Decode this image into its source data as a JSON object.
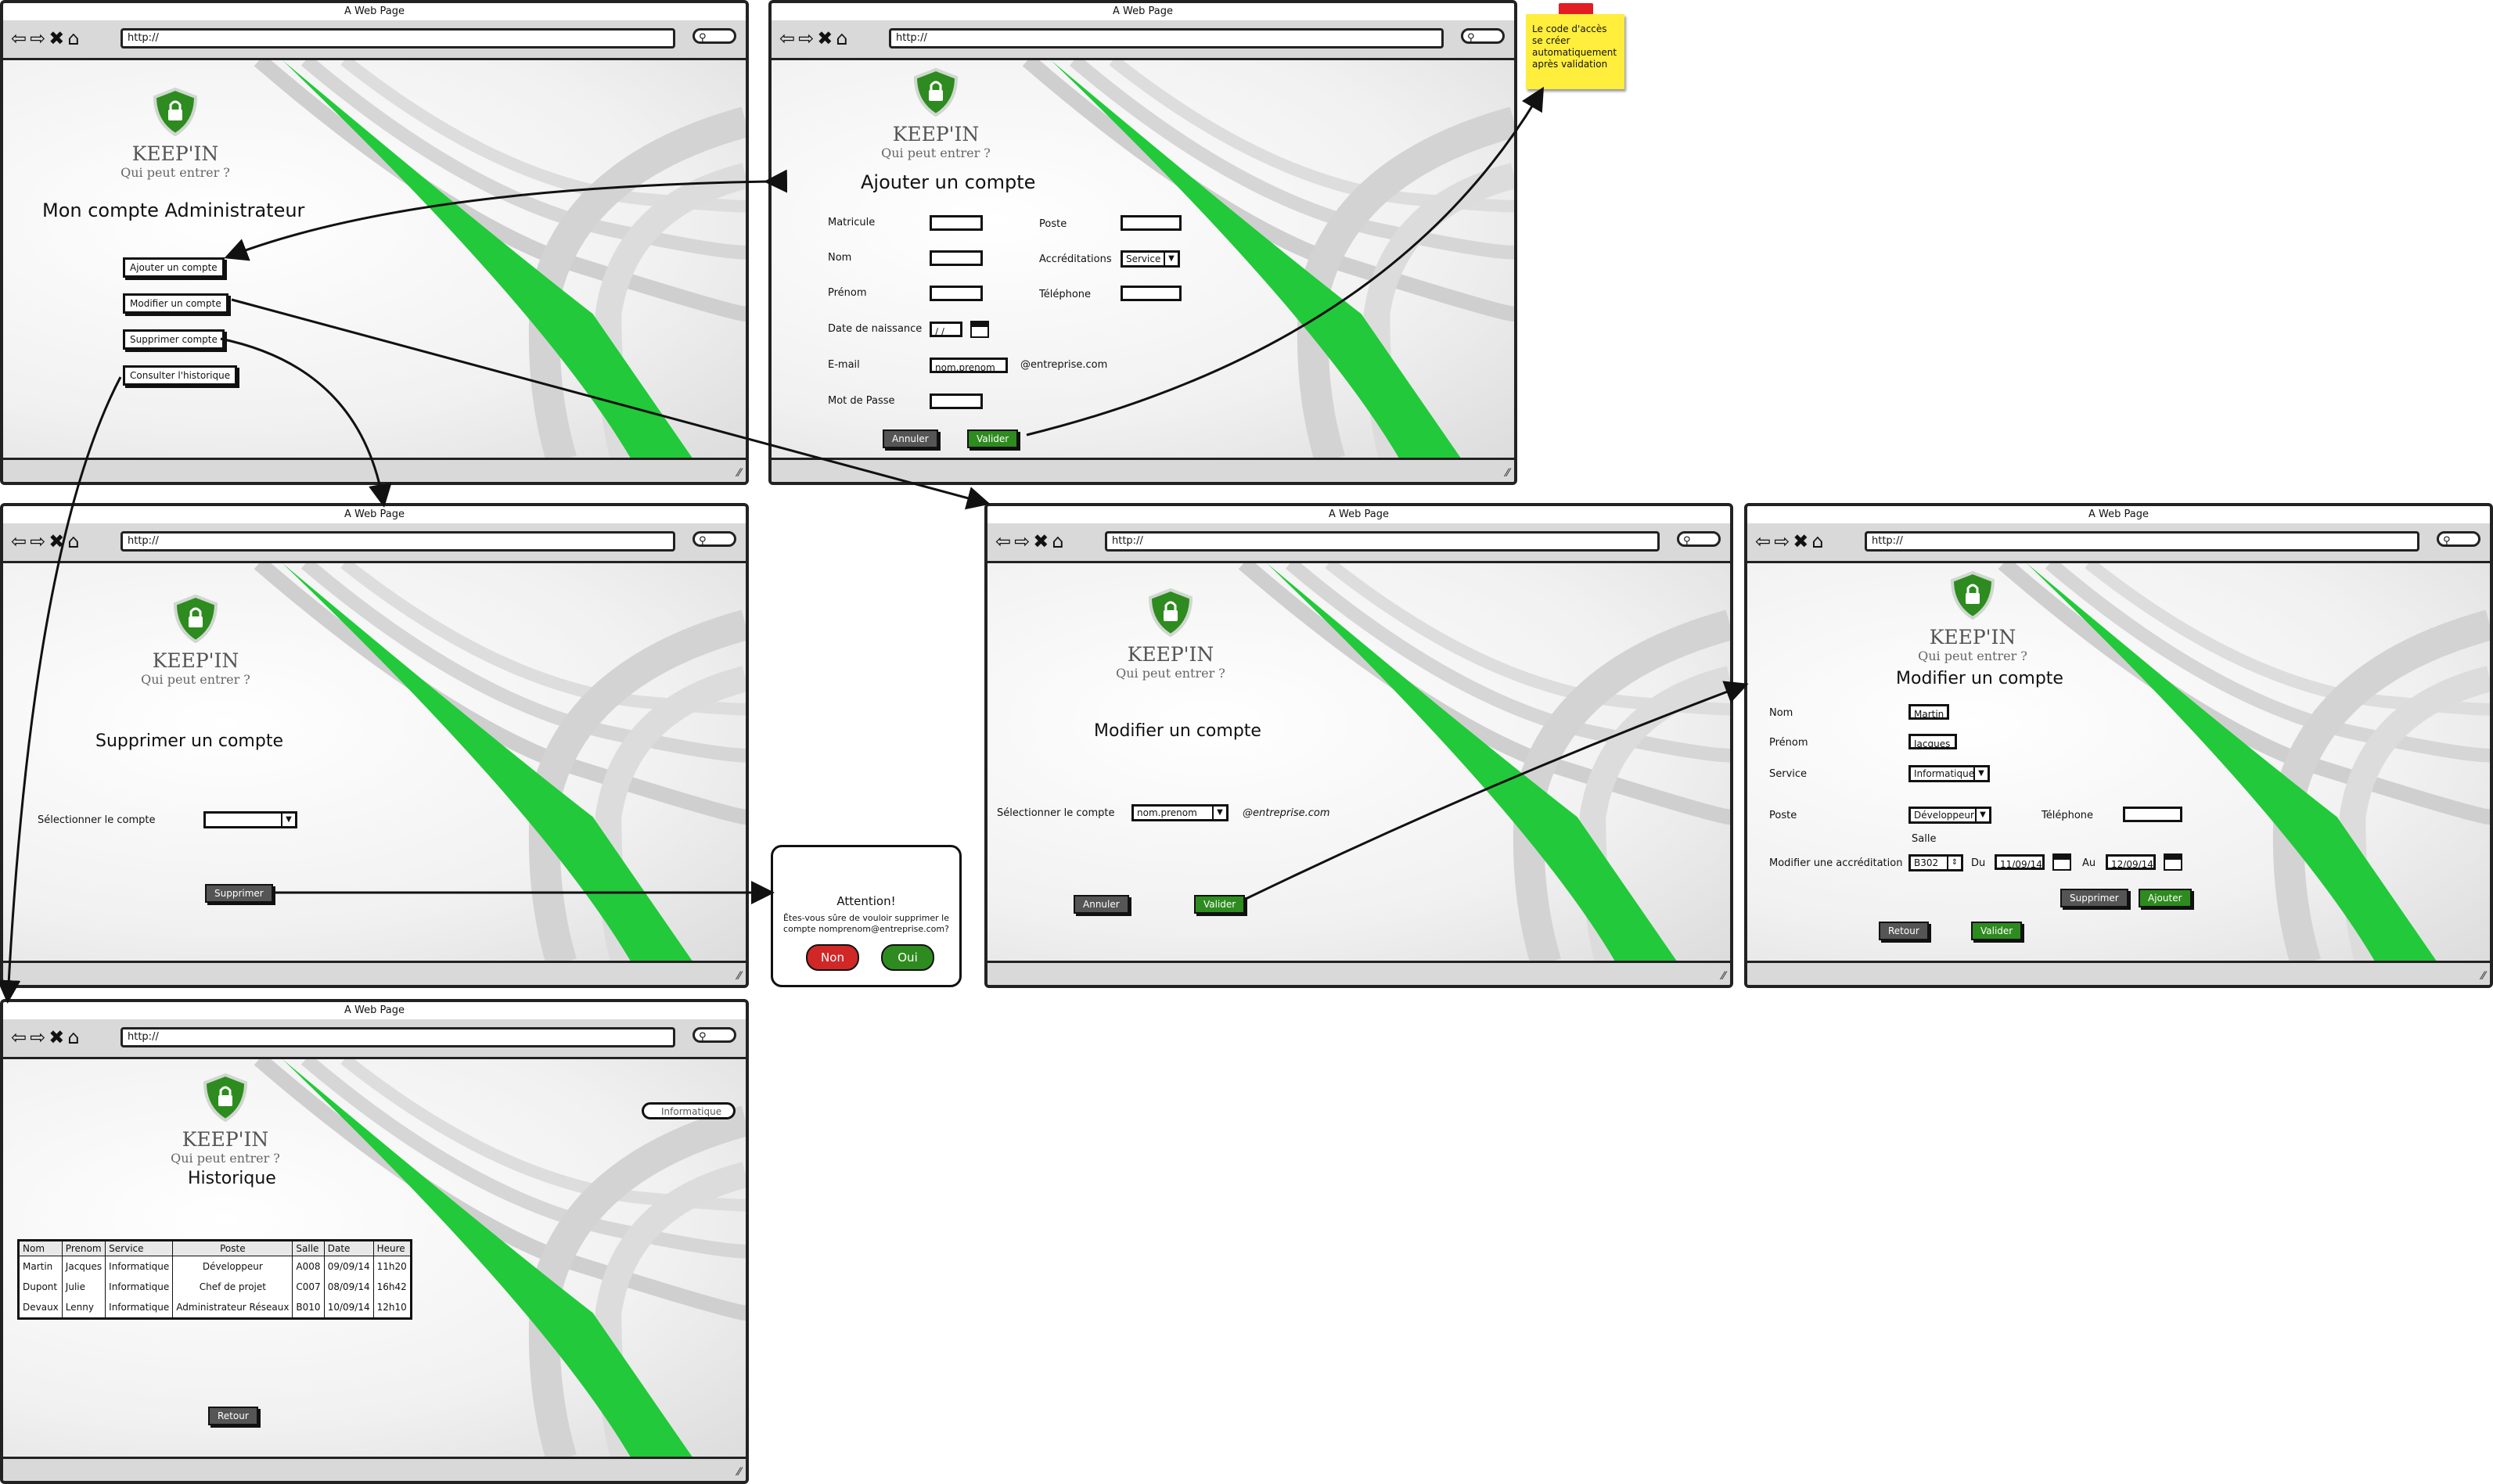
{
  "browser": {
    "title": "A Web Page",
    "url": "http://"
  },
  "brand": {
    "name": "KEEP'IN",
    "slogan": "Qui peut entrer ?"
  },
  "colors": {
    "accent_green": "#2e8b1f",
    "stripe_green": "#22c93a",
    "danger_red": "#d22727",
    "note_yellow": "#ffee3b"
  },
  "admin": {
    "title": "Mon compte Administrateur",
    "buttons": [
      "Ajouter un compte",
      "Modifier un compte",
      "Supprimer compte",
      "Consulter l'historique"
    ]
  },
  "add": {
    "title": "Ajouter un compte",
    "labels": {
      "matricule": "Matricule",
      "nom": "Nom",
      "prenom": "Prénom",
      "naissance": "Date de naissance",
      "email": "E-mail",
      "mdp": "Mot de Passe",
      "poste": "Poste",
      "accreditations": "Accréditations",
      "telephone": "Téléphone"
    },
    "date_value": "/ /",
    "email_value": "nom.prenom",
    "email_domain": "@entreprise.com",
    "accreditation_value": "Service",
    "cancel": "Annuler",
    "validate": "Valider"
  },
  "note": {
    "text": "Le code d'accès se créer automatiquement après validation"
  },
  "delete": {
    "title": "Supprimer un compte",
    "select_label": "Sélectionner le compte",
    "button": "Supprimer"
  },
  "dialog": {
    "title": "Attention!",
    "text": "Êtes-vous sûre de vouloir supprimer le compte nomprenom@entreprise.com?",
    "no": "Non",
    "yes": "Oui"
  },
  "modify": {
    "title": "Modifier un compte",
    "select_label": "Sélectionner le compte",
    "select_value": "nom.prenom",
    "domain": "@entreprise.com",
    "cancel": "Annuler",
    "validate": "Valider"
  },
  "edit": {
    "title": "Modifier un compte",
    "labels": {
      "nom": "Nom",
      "prenom": "Prénom",
      "service": "Service",
      "poste": "Poste",
      "telephone": "Téléphone",
      "salle": "Salle",
      "accreditation": "Modifier une accréditation",
      "du": "Du",
      "au": "Au"
    },
    "values": {
      "nom": "Martin",
      "prenom": "Jacques",
      "service": "Informatique",
      "poste": "Développeur",
      "salle": "B302",
      "du": "11/09/14",
      "au": "12/09/14"
    },
    "buttons": {
      "supprimer": "Supprimer",
      "ajouter": "Ajouter",
      "retour": "Retour",
      "valider": "Valider"
    }
  },
  "history": {
    "title": "Historique",
    "filter": "Informatique",
    "columns": [
      "Nom",
      "Prenom",
      "Service",
      "Poste",
      "Salle",
      "Date",
      "Heure"
    ],
    "rows": [
      [
        "Martin",
        "Jacques",
        "Informatique",
        "Développeur",
        "A008",
        "09/09/14",
        "11h20"
      ],
      [
        "Dupont",
        "Julie",
        "Informatique",
        "Chef de projet",
        "C007",
        "08/09/14",
        "16h42"
      ],
      [
        "Devaux",
        "Lenny",
        "Informatique",
        "Administrateur Réseaux",
        "B010",
        "10/09/14",
        "12h10"
      ]
    ],
    "back": "Retour"
  }
}
